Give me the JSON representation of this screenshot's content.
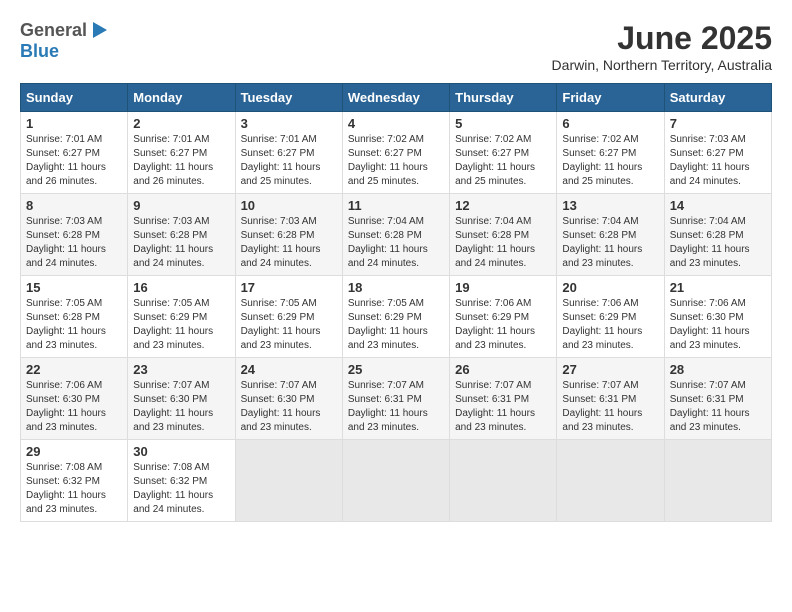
{
  "header": {
    "logo_general": "General",
    "logo_blue": "Blue",
    "month_year": "June 2025",
    "location": "Darwin, Northern Territory, Australia"
  },
  "days_of_week": [
    "Sunday",
    "Monday",
    "Tuesday",
    "Wednesday",
    "Thursday",
    "Friday",
    "Saturday"
  ],
  "weeks": [
    [
      {
        "day": "1",
        "sunrise": "7:01 AM",
        "sunset": "6:27 PM",
        "daylight": "11 hours and 26 minutes."
      },
      {
        "day": "2",
        "sunrise": "7:01 AM",
        "sunset": "6:27 PM",
        "daylight": "11 hours and 26 minutes."
      },
      {
        "day": "3",
        "sunrise": "7:01 AM",
        "sunset": "6:27 PM",
        "daylight": "11 hours and 25 minutes."
      },
      {
        "day": "4",
        "sunrise": "7:02 AM",
        "sunset": "6:27 PM",
        "daylight": "11 hours and 25 minutes."
      },
      {
        "day": "5",
        "sunrise": "7:02 AM",
        "sunset": "6:27 PM",
        "daylight": "11 hours and 25 minutes."
      },
      {
        "day": "6",
        "sunrise": "7:02 AM",
        "sunset": "6:27 PM",
        "daylight": "11 hours and 25 minutes."
      },
      {
        "day": "7",
        "sunrise": "7:03 AM",
        "sunset": "6:27 PM",
        "daylight": "11 hours and 24 minutes."
      }
    ],
    [
      {
        "day": "8",
        "sunrise": "7:03 AM",
        "sunset": "6:28 PM",
        "daylight": "11 hours and 24 minutes."
      },
      {
        "day": "9",
        "sunrise": "7:03 AM",
        "sunset": "6:28 PM",
        "daylight": "11 hours and 24 minutes."
      },
      {
        "day": "10",
        "sunrise": "7:03 AM",
        "sunset": "6:28 PM",
        "daylight": "11 hours and 24 minutes."
      },
      {
        "day": "11",
        "sunrise": "7:04 AM",
        "sunset": "6:28 PM",
        "daylight": "11 hours and 24 minutes."
      },
      {
        "day": "12",
        "sunrise": "7:04 AM",
        "sunset": "6:28 PM",
        "daylight": "11 hours and 24 minutes."
      },
      {
        "day": "13",
        "sunrise": "7:04 AM",
        "sunset": "6:28 PM",
        "daylight": "11 hours and 23 minutes."
      },
      {
        "day": "14",
        "sunrise": "7:04 AM",
        "sunset": "6:28 PM",
        "daylight": "11 hours and 23 minutes."
      }
    ],
    [
      {
        "day": "15",
        "sunrise": "7:05 AM",
        "sunset": "6:28 PM",
        "daylight": "11 hours and 23 minutes."
      },
      {
        "day": "16",
        "sunrise": "7:05 AM",
        "sunset": "6:29 PM",
        "daylight": "11 hours and 23 minutes."
      },
      {
        "day": "17",
        "sunrise": "7:05 AM",
        "sunset": "6:29 PM",
        "daylight": "11 hours and 23 minutes."
      },
      {
        "day": "18",
        "sunrise": "7:05 AM",
        "sunset": "6:29 PM",
        "daylight": "11 hours and 23 minutes."
      },
      {
        "day": "19",
        "sunrise": "7:06 AM",
        "sunset": "6:29 PM",
        "daylight": "11 hours and 23 minutes."
      },
      {
        "day": "20",
        "sunrise": "7:06 AM",
        "sunset": "6:29 PM",
        "daylight": "11 hours and 23 minutes."
      },
      {
        "day": "21",
        "sunrise": "7:06 AM",
        "sunset": "6:30 PM",
        "daylight": "11 hours and 23 minutes."
      }
    ],
    [
      {
        "day": "22",
        "sunrise": "7:06 AM",
        "sunset": "6:30 PM",
        "daylight": "11 hours and 23 minutes."
      },
      {
        "day": "23",
        "sunrise": "7:07 AM",
        "sunset": "6:30 PM",
        "daylight": "11 hours and 23 minutes."
      },
      {
        "day": "24",
        "sunrise": "7:07 AM",
        "sunset": "6:30 PM",
        "daylight": "11 hours and 23 minutes."
      },
      {
        "day": "25",
        "sunrise": "7:07 AM",
        "sunset": "6:31 PM",
        "daylight": "11 hours and 23 minutes."
      },
      {
        "day": "26",
        "sunrise": "7:07 AM",
        "sunset": "6:31 PM",
        "daylight": "11 hours and 23 minutes."
      },
      {
        "day": "27",
        "sunrise": "7:07 AM",
        "sunset": "6:31 PM",
        "daylight": "11 hours and 23 minutes."
      },
      {
        "day": "28",
        "sunrise": "7:07 AM",
        "sunset": "6:31 PM",
        "daylight": "11 hours and 23 minutes."
      }
    ],
    [
      {
        "day": "29",
        "sunrise": "7:08 AM",
        "sunset": "6:32 PM",
        "daylight": "11 hours and 23 minutes."
      },
      {
        "day": "30",
        "sunrise": "7:08 AM",
        "sunset": "6:32 PM",
        "daylight": "11 hours and 24 minutes."
      },
      null,
      null,
      null,
      null,
      null
    ]
  ]
}
